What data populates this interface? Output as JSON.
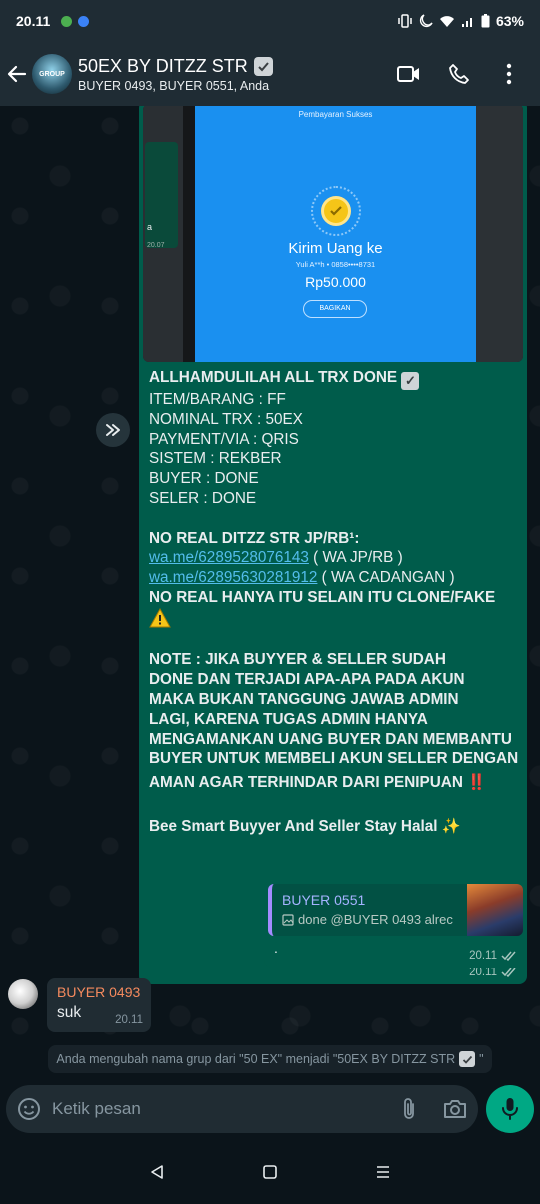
{
  "status_bar": {
    "time": "20.11",
    "battery": "63%",
    "icons": [
      "vibrate-icon",
      "moon-icon",
      "wifi-icon",
      "signal-icon",
      "battery-icon"
    ]
  },
  "header": {
    "group_name": "50EX BY DITZZ STR",
    "members": "BUYER 0493, BUYER 0551, Anda",
    "avatar_text": "GROUP",
    "icons": [
      "back-arrow-icon",
      "video-call-icon",
      "voice-call-icon",
      "more-options-icon"
    ]
  },
  "payment_image": {
    "title": "Pembayaran Sukses",
    "heading": "Kirim Uang ke",
    "recipient": "Yuli A**h • 0858••••8731",
    "amount": "Rp50.000",
    "button": "BAGIKAN",
    "mini_text": "a",
    "mini_time": "20.07"
  },
  "main_message": {
    "lines": [
      {
        "text": "ALLHAMDULILAH ALL TRX DONE",
        "bold": true,
        "suffix": "badge"
      },
      {
        "text": "ITEM/BARANG : FF"
      },
      {
        "text": "NOMINAL TRX : 50EX"
      },
      {
        "text": "PAYMENT/VIA : QRIS"
      },
      {
        "text": "SISTEM : REKBER"
      },
      {
        "text": "BUYER : DONE"
      },
      {
        "text": "SELER : DONE"
      }
    ],
    "no_real_heading": "NO REAL DITZZ STR JP/RB¹:",
    "link1": "wa.me/6289528076143",
    "link1_note": " ( WA JP/RB )",
    "link2": "wa.me/62895630281912",
    "link2_note": " ( WA CADANGAN )",
    "clone_warning": "NO REAL HANYA ITU SELAIN ITU CLONE/FAKE",
    "note_lines": [
      "NOTE : JIKA BUYYER & SELLER SUDAH",
      "DONE DAN TERJADI APA-APA PADA AKUN",
      "MAKA BUKAN TANGGUNG JAWAB ADMIN",
      "LAGI, KARENA TUGAS ADMIN HANYA",
      "MENGAMANKAN UANG BUYER DAN MEMBANTU",
      "BUYER UNTUK MEMBELI AKUN SELLER DENGAN",
      "AMAN AGAR TERHINDAR DARI PENIPUAN"
    ],
    "note_emoji": "‼️",
    "closing": "Bee Smart Buyyer And Seller Stay Halal",
    "closing_emoji": "✨",
    "time": "20.11"
  },
  "reply_message": {
    "quoted_name": "BUYER 0551",
    "quoted_text": "done @BUYER 0493 alrec",
    "text": ".",
    "time": "20.11"
  },
  "incoming_message": {
    "sender": "BUYER 0493",
    "text": "suk",
    "time": "20.11"
  },
  "system_message": {
    "text": "Anda mengubah nama grup dari \"50 EX\" menjadi \"50EX BY DITZZ STR",
    "suffix": "\""
  },
  "composer": {
    "placeholder": "Ketik pesan",
    "icons": [
      "emoji-icon",
      "attach-icon",
      "camera-icon",
      "mic-icon"
    ]
  },
  "nav": {
    "icons": [
      "back-triangle-icon",
      "home-square-icon",
      "recents-icon"
    ]
  },
  "colors": {
    "outgoing_bubble": "#005c4b",
    "incoming_bubble": "#202c33",
    "link": "#53bdeb",
    "accent": "#00a884",
    "header": "#1f2c34"
  }
}
